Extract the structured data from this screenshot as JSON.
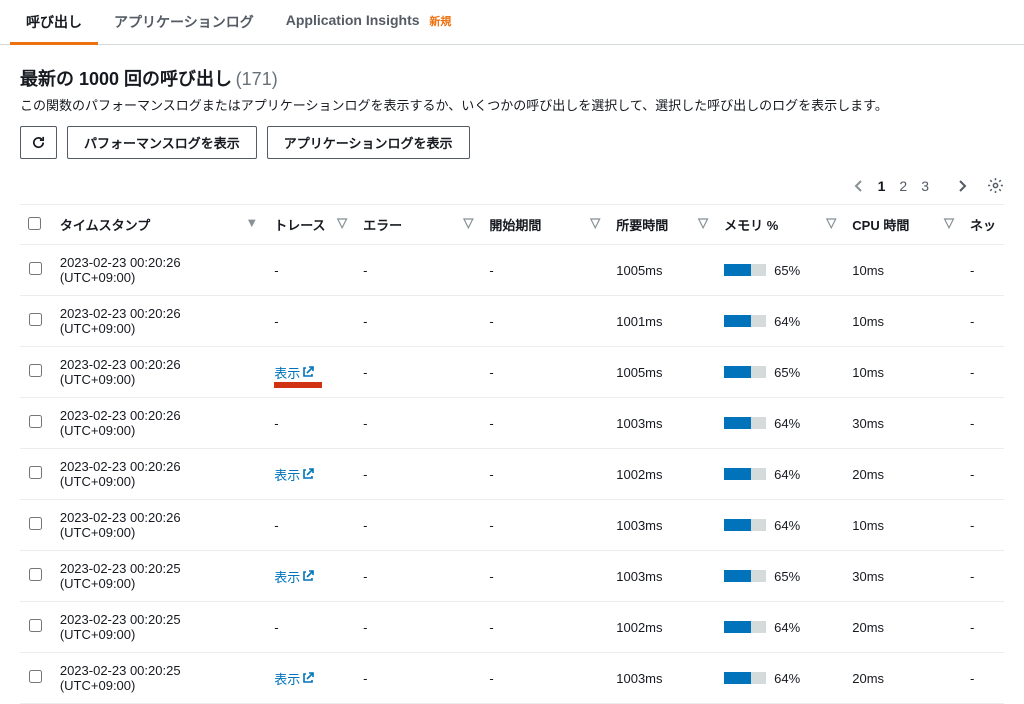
{
  "tabs": {
    "invocations": "呼び出し",
    "app_logs": "アプリケーションログ",
    "insights": "Application Insights",
    "insights_badge": "新規"
  },
  "header": {
    "title_prefix": "最新の 1000 回の呼び出し",
    "count": "(171)",
    "subtitle": "この関数のパフォーマンスログまたはアプリケーションログを表示するか、いくつかの呼び出しを選択して、選択した呼び出しのログを表示します。"
  },
  "buttons": {
    "perf_logs": "パフォーマンスログを表示",
    "app_logs": "アプリケーションログを表示"
  },
  "pagination": {
    "pages": [
      "1",
      "2",
      "3"
    ],
    "active": 0
  },
  "columns": {
    "timestamp": "タイムスタンプ",
    "trace": "トレース",
    "error": "エラー",
    "start": "開始期間",
    "duration": "所要時間",
    "memory": "メモリ %",
    "cpu": "CPU 時間",
    "network": "ネッ"
  },
  "trace_label": "表示",
  "rows": [
    {
      "ts": "2023-02-23 00:20:26 (UTC+09:00)",
      "trace": null,
      "error": "-",
      "start": "-",
      "dur": "1005ms",
      "mem": 65,
      "cpu": "10ms",
      "net": "-"
    },
    {
      "ts": "2023-02-23 00:20:26 (UTC+09:00)",
      "trace": null,
      "error": "-",
      "start": "-",
      "dur": "1001ms",
      "mem": 64,
      "cpu": "10ms",
      "net": "-"
    },
    {
      "ts": "2023-02-23 00:20:26 (UTC+09:00)",
      "trace": "highlight",
      "error": "-",
      "start": "-",
      "dur": "1005ms",
      "mem": 65,
      "cpu": "10ms",
      "net": "-"
    },
    {
      "ts": "2023-02-23 00:20:26 (UTC+09:00)",
      "trace": null,
      "error": "-",
      "start": "-",
      "dur": "1003ms",
      "mem": 64,
      "cpu": "30ms",
      "net": "-"
    },
    {
      "ts": "2023-02-23 00:20:26 (UTC+09:00)",
      "trace": "link",
      "error": "-",
      "start": "-",
      "dur": "1002ms",
      "mem": 64,
      "cpu": "20ms",
      "net": "-"
    },
    {
      "ts": "2023-02-23 00:20:26 (UTC+09:00)",
      "trace": null,
      "error": "-",
      "start": "-",
      "dur": "1003ms",
      "mem": 64,
      "cpu": "10ms",
      "net": "-"
    },
    {
      "ts": "2023-02-23 00:20:25 (UTC+09:00)",
      "trace": "link",
      "error": "-",
      "start": "-",
      "dur": "1003ms",
      "mem": 65,
      "cpu": "30ms",
      "net": "-"
    },
    {
      "ts": "2023-02-23 00:20:25 (UTC+09:00)",
      "trace": null,
      "error": "-",
      "start": "-",
      "dur": "1002ms",
      "mem": 64,
      "cpu": "20ms",
      "net": "-"
    },
    {
      "ts": "2023-02-23 00:20:25 (UTC+09:00)",
      "trace": "link",
      "error": "-",
      "start": "-",
      "dur": "1003ms",
      "mem": 64,
      "cpu": "20ms",
      "net": "-"
    }
  ]
}
